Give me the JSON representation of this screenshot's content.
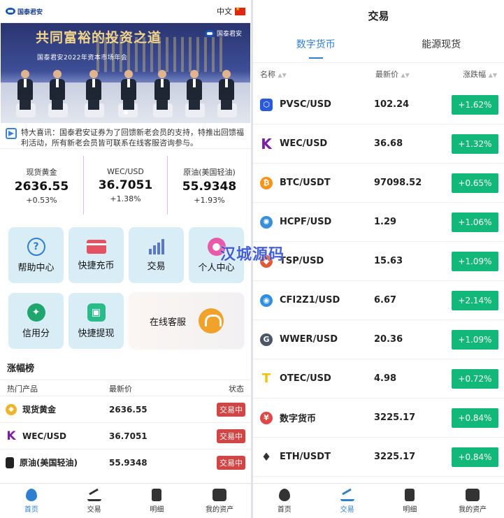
{
  "left": {
    "logo_text": "国泰君安",
    "lang_label": "中文",
    "banner": {
      "title": "共同富裕的投资之道",
      "brand": "国泰君安",
      "subtitle": "国泰君安2022年资本市场年会"
    },
    "notice": "特大喜讯：国泰君安证券为了回馈新老会员的支持，特推出回馈福利活动，所有新老会员皆可联系在线客服咨询参与。",
    "quotes": [
      {
        "name": "现货黄金",
        "price": "2636.55",
        "change": "+0.53%"
      },
      {
        "name": "WEC/USD",
        "price": "36.7051",
        "change": "+1.38%"
      },
      {
        "name": "原油(美国轻油)",
        "price": "55.9348",
        "change": "+1.93%"
      }
    ],
    "tiles": {
      "help": "帮助中心",
      "recharge": "快捷充币",
      "trade": "交易",
      "profile": "个人中心",
      "credit": "信用分",
      "withdraw": "快捷提现",
      "cs": "在线客服"
    },
    "watermark": "汉城源码",
    "gainers": {
      "title": "涨幅榜",
      "headers": [
        "热门产品",
        "最新价",
        "状态"
      ],
      "rows": [
        {
          "name": "现货黄金",
          "price": "2636.55",
          "status": "交易中"
        },
        {
          "name": "WEC/USD",
          "price": "36.7051",
          "status": "交易中"
        },
        {
          "name": "原油(美国轻油)",
          "price": "55.9348",
          "status": "交易中"
        }
      ]
    },
    "tabbar": [
      "首页",
      "交易",
      "明细",
      "我的资产"
    ]
  },
  "right": {
    "title": "交易",
    "tabs": [
      "数字货币",
      "能源现货"
    ],
    "headers": {
      "name": "名称",
      "price": "最新价",
      "change": "涨跌幅"
    },
    "rows": [
      {
        "name": "PVSC/USD",
        "price": "102.24",
        "change": "+1.62%"
      },
      {
        "name": "WEC/USD",
        "price": "36.68",
        "change": "+1.32%"
      },
      {
        "name": "BTC/USDT",
        "price": "97098.52",
        "change": "+0.65%"
      },
      {
        "name": "HCPF/USD",
        "price": "1.29",
        "change": "+1.06%"
      },
      {
        "name": "TSP/USD",
        "price": "15.63",
        "change": "+1.09%"
      },
      {
        "name": "CFI2Z1/USD",
        "price": "6.67",
        "change": "+2.14%"
      },
      {
        "name": "WWER/USD",
        "price": "20.36",
        "change": "+1.09%"
      },
      {
        "name": "OTEC/USD",
        "price": "4.98",
        "change": "+0.72%"
      },
      {
        "name": "数字货币",
        "price": "3225.17",
        "change": "+0.84%"
      },
      {
        "name": "ETH/USDT",
        "price": "3225.17",
        "change": "+0.84%"
      }
    ],
    "tabbar": [
      "首页",
      "交易",
      "明细",
      "我的资产"
    ]
  },
  "colors": {
    "accent": "#2f7fd1",
    "up_badge": "#12b77a",
    "trading_tag": "#d24545"
  }
}
